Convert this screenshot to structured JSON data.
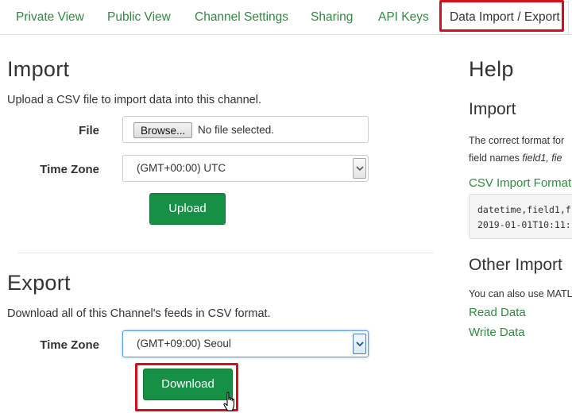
{
  "tabs": [
    {
      "label": "Private View"
    },
    {
      "label": "Public View"
    },
    {
      "label": "Channel Settings"
    },
    {
      "label": "Sharing"
    },
    {
      "label": "API Keys"
    },
    {
      "label": "Data Import / Export"
    }
  ],
  "import": {
    "title": "Import",
    "description": "Upload a CSV file to import data into this channel.",
    "file_label": "File",
    "browse_label": "Browse...",
    "file_status": "No file selected.",
    "timezone_label": "Time Zone",
    "timezone_value": "(GMT+00:00) UTC",
    "upload_label": "Upload"
  },
  "export": {
    "title": "Export",
    "description": "Download all of this Channel's feeds in CSV format.",
    "timezone_label": "Time Zone",
    "timezone_value": "(GMT+09:00) Seoul",
    "download_label": "Download"
  },
  "help": {
    "title": "Help",
    "import_title": "Import",
    "import_text_line1": "The correct format for",
    "import_text_line2_prefix": "field names ",
    "import_text_line2_field": "field1",
    "import_text_line2_rest": ", fie",
    "csv_link": "CSV Import Format",
    "code_line1": "datetime,field1,f",
    "code_line2": "2019-01-01T10:11:",
    "other_title": "Other Import",
    "other_text": "You can also use MATL",
    "links": [
      "Read Data",
      "Write Data"
    ]
  },
  "colors": {
    "accent_green": "#2e8b3e",
    "button_green": "#159045",
    "highlight_red": "#d0101b"
  }
}
